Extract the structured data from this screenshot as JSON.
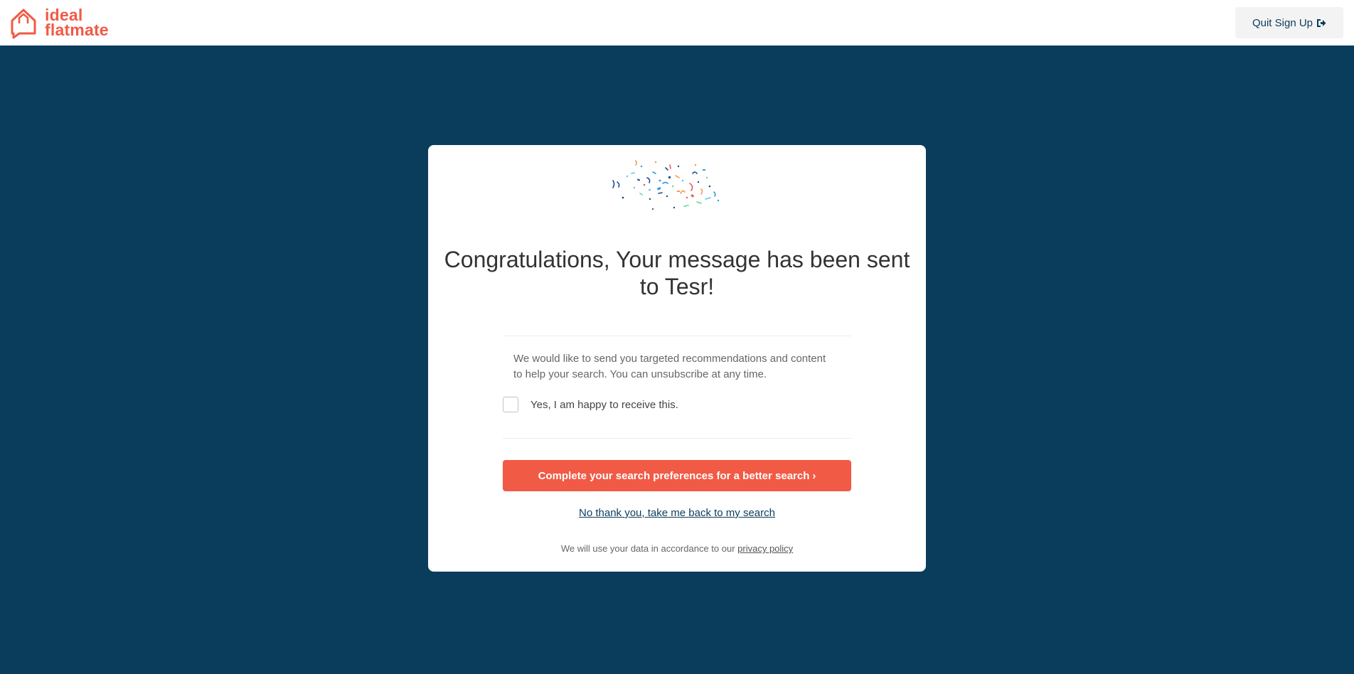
{
  "header": {
    "logo_line1": "ideal",
    "logo_line2": "flatmate",
    "quit_label": "Quit Sign Up",
    "quit_icon": "sign-out-icon"
  },
  "card": {
    "confetti_icon": "confetti-icon",
    "headline": "Congratulations, Your message has been sent to Tesr!",
    "consent_text": "We would like to send you targeted recommendations and content to help your search. You can unsubscribe at any time.",
    "consent_checkbox_label": "Yes, I am happy to receive this.",
    "consent_checked": false,
    "cta_label": "Complete your search preferences for a better search",
    "cta_chevron": "›",
    "back_link": "No thank you, take me back to my search",
    "footnote_prefix": "We will use your data in accordance to our ",
    "privacy_link": "privacy policy"
  },
  "colors": {
    "background": "#0a3c5c",
    "brand": "#f15a45",
    "card": "#ffffff",
    "quit_button_bg": "#f3f3f3"
  }
}
